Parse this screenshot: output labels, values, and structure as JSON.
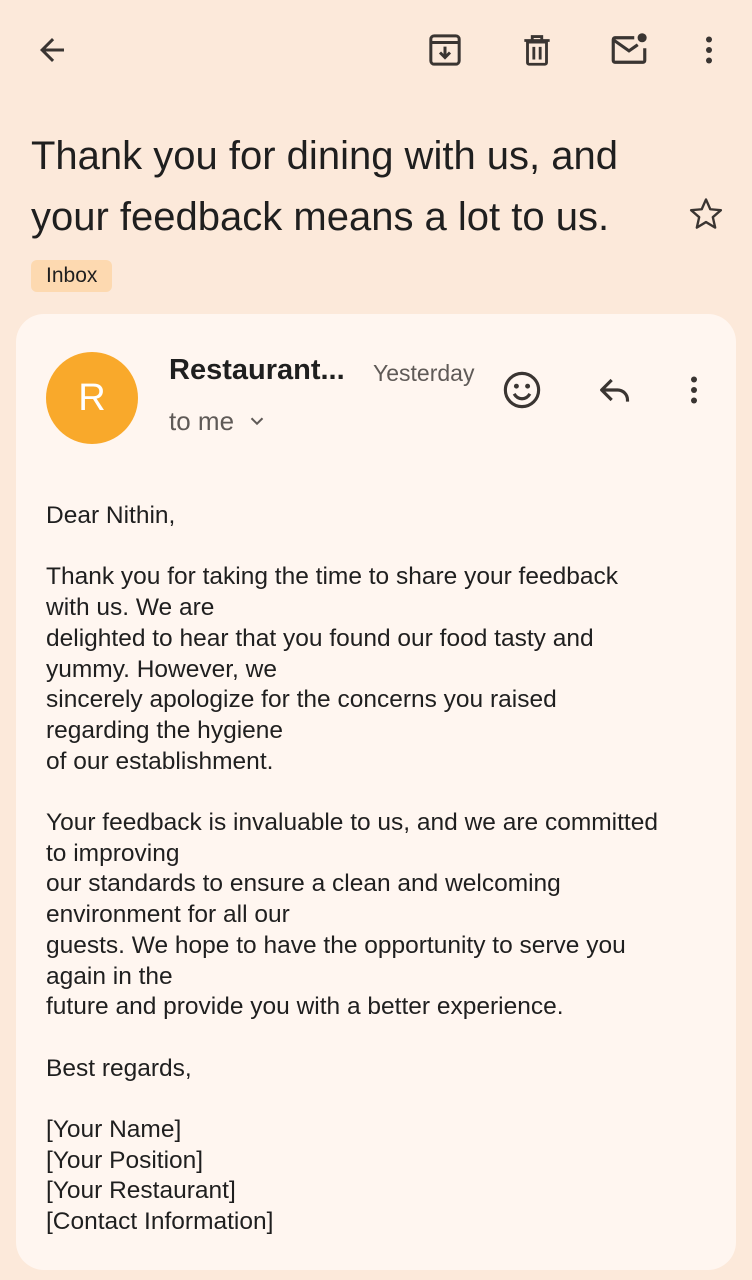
{
  "header": {
    "icons": [
      "back-arrow-icon",
      "archive-icon",
      "delete-icon",
      "mark-unread-icon",
      "more-vert-icon"
    ]
  },
  "email": {
    "subject": "Thank you for dining with us, and your feedback means a lot to us.",
    "label": "Inbox",
    "sender_initial": "R",
    "sender_name": "Restaurant...",
    "date": "Yesterday",
    "recipient": "to me",
    "avatar_color": "#f9a92b",
    "body": {
      "greeting": "Dear Nithin,",
      "p1": [
        "Thank you for taking the time to share your feedback",
        "with us. We are",
        "delighted to hear that you found our food tasty and",
        "yummy. However, we",
        "sincerely apologize for the concerns you raised",
        "regarding the hygiene",
        "of our establishment."
      ],
      "p2": [
        "Your feedback is invaluable to us, and we are committed",
        "to improving",
        "our standards to ensure a clean and welcoming",
        "environment for all our",
        "guests. We hope to have the opportunity to serve you",
        "again in the",
        "future and provide you with a better experience."
      ],
      "closing": "Best regards,",
      "signature": [
        "[Your Name]",
        "[Your Position]",
        "[Your Restaurant]",
        "[Contact Information]"
      ]
    }
  },
  "colors": {
    "background": "#fce9da",
    "card": "#fff6f0",
    "label_chip": "#fdd9b0"
  }
}
